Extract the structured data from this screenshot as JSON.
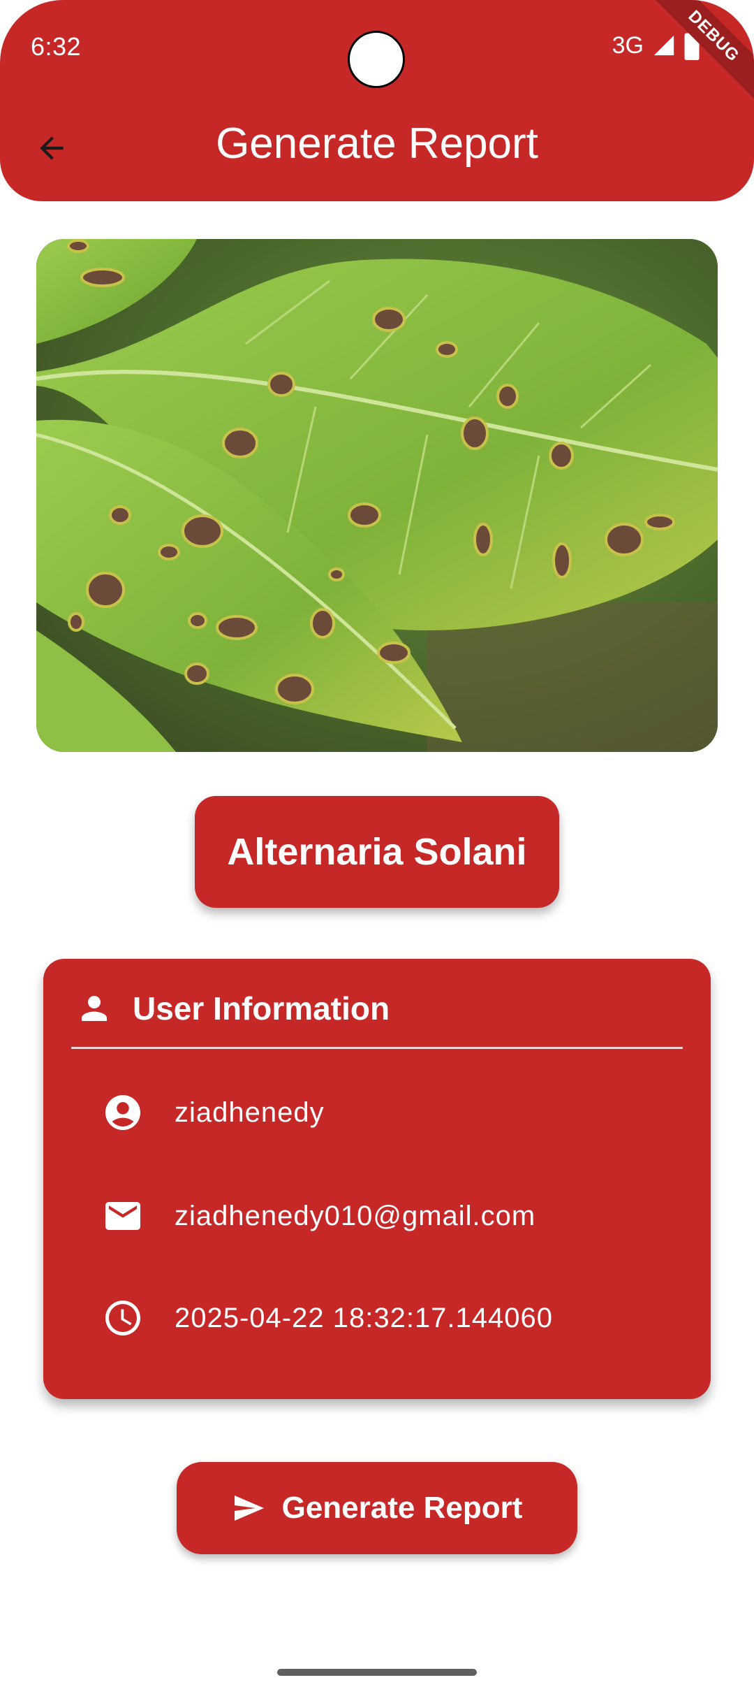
{
  "status_bar": {
    "time": "6:32",
    "network": "3G",
    "debug_label": "DEBUG"
  },
  "app_bar": {
    "title": "Generate Report",
    "back_icon": "arrow-back-icon"
  },
  "diagnosis": {
    "label": "Alternaria Solani"
  },
  "user_card": {
    "title": "User Information",
    "title_icon": "person-icon",
    "username": "ziadhenedy",
    "username_icon": "account-circle-icon",
    "email": "ziadhenedy010@gmail.com",
    "email_icon": "mail-icon",
    "timestamp": "2025-04-22 18:32:17.144060",
    "timestamp_icon": "clock-icon"
  },
  "actions": {
    "generate_label": "Generate Report",
    "generate_icon": "send-icon"
  },
  "colors": {
    "primary": "#C62828",
    "on_primary": "#FFFFFF"
  }
}
